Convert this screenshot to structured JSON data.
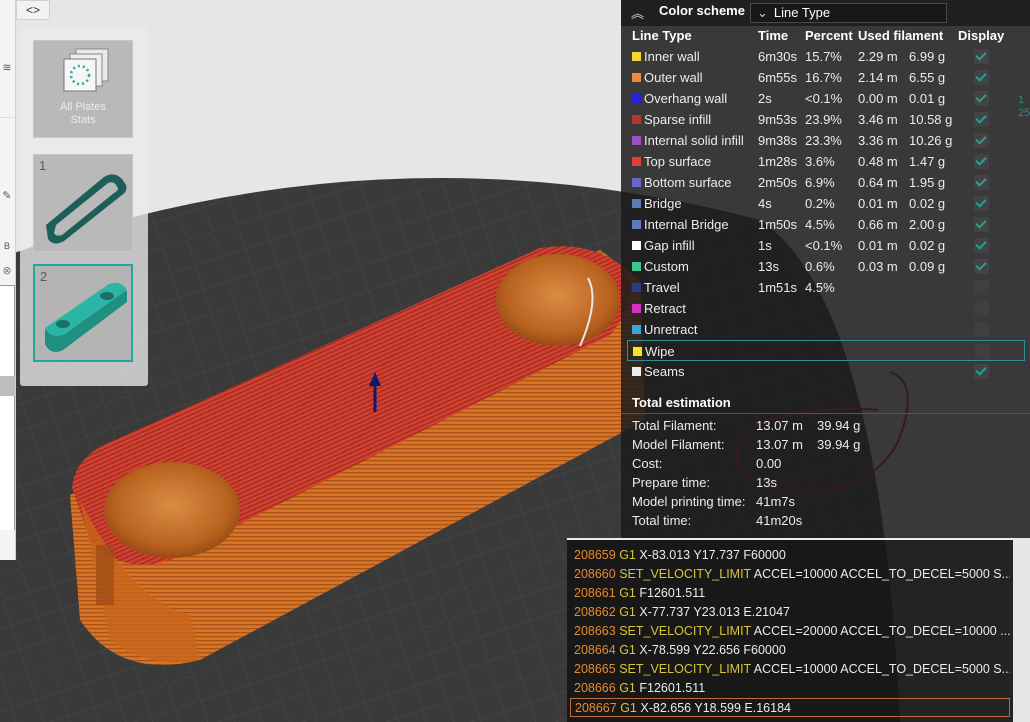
{
  "left_strip": {
    "icons": [
      "wifi-icon",
      "edit-icon",
      "b-badge-icon",
      "close-circle-icon"
    ],
    "badge_text": "B"
  },
  "collapse_glyph": "<>",
  "plates": {
    "all_label_line1": "All Plates",
    "all_label_line2": "Stats",
    "items": [
      {
        "number": "1"
      },
      {
        "number": "2"
      }
    ]
  },
  "legend": {
    "scheme_label": "Color scheme",
    "scheme_value": "Line Type",
    "headers": {
      "type": "Line Type",
      "time": "Time",
      "percent": "Percent",
      "filament": "Used filament",
      "display": "Display"
    },
    "rows": [
      {
        "name": "Inner wall",
        "color": "#f5d535",
        "time": "6m30s",
        "percent": "15.7%",
        "length": "2.29 m",
        "weight": "6.99 g",
        "checked": true
      },
      {
        "name": "Outer wall",
        "color": "#f0893a",
        "time": "6m55s",
        "percent": "16.7%",
        "length": "2.14 m",
        "weight": "6.55 g",
        "checked": true
      },
      {
        "name": "Overhang wall",
        "color": "#2323d8",
        "time": "2s",
        "percent": "<0.1%",
        "length": "0.00 m",
        "weight": "0.01 g",
        "checked": true
      },
      {
        "name": "Sparse infill",
        "color": "#b13a2e",
        "time": "9m53s",
        "percent": "23.9%",
        "length": "3.46 m",
        "weight": "10.58 g",
        "checked": true
      },
      {
        "name": "Internal solid infill",
        "color": "#9a4fc4",
        "time": "9m38s",
        "percent": "23.3%",
        "length": "3.36 m",
        "weight": "10.26 g",
        "checked": true
      },
      {
        "name": "Top surface",
        "color": "#e23c3c",
        "time": "1m28s",
        "percent": "3.6%",
        "length": "0.48 m",
        "weight": "1.47 g",
        "checked": true
      },
      {
        "name": "Bottom surface",
        "color": "#6a64c8",
        "time": "2m50s",
        "percent": "6.9%",
        "length": "0.64 m",
        "weight": "1.95 g",
        "checked": true
      },
      {
        "name": "Bridge",
        "color": "#5d7ab8",
        "time": "4s",
        "percent": "0.2%",
        "length": "0.01 m",
        "weight": "0.02 g",
        "checked": true
      },
      {
        "name": "Internal Bridge",
        "color": "#5d7ab8",
        "time": "1m50s",
        "percent": "4.5%",
        "length": "0.66 m",
        "weight": "2.00 g",
        "checked": true
      },
      {
        "name": "Gap infill",
        "color": "#ffffff",
        "time": "1s",
        "percent": "<0.1%",
        "length": "0.01 m",
        "weight": "0.02 g",
        "checked": true
      },
      {
        "name": "Custom",
        "color": "#3ec48a",
        "time": "13s",
        "percent": "0.6%",
        "length": "0.03 m",
        "weight": "0.09 g",
        "checked": true
      },
      {
        "name": "Travel",
        "color": "#2e3a8c",
        "time": "1m51s",
        "percent": "4.5%",
        "length": "",
        "weight": "",
        "checked": false
      },
      {
        "name": "Retract",
        "color": "#d42ec4",
        "time": "",
        "percent": "",
        "length": "",
        "weight": "",
        "checked": false
      },
      {
        "name": "Unretract",
        "color": "#3aa6d4",
        "time": "",
        "percent": "",
        "length": "",
        "weight": "",
        "checked": false
      },
      {
        "name": "Wipe",
        "color": "#f5e61a",
        "time": "",
        "percent": "",
        "length": "",
        "weight": "",
        "checked": false
      },
      {
        "name": "Seams",
        "color": "#eeeeee",
        "time": "",
        "percent": "",
        "length": "",
        "weight": "",
        "checked": true
      }
    ],
    "estimation_title": "Total estimation",
    "estimation": [
      {
        "label": "Total Filament:",
        "v1": "13.07 m",
        "v2": "39.94 g"
      },
      {
        "label": "Model Filament:",
        "v1": "13.07 m",
        "v2": "39.94 g"
      },
      {
        "label": "Cost:",
        "v1": "0.00",
        "v2": ""
      },
      {
        "label": "Prepare time:",
        "v1": "13s",
        "v2": ""
      },
      {
        "label": "Model printing time:",
        "v1": "41m7s",
        "v2": ""
      },
      {
        "label": "Total time:",
        "v1": "41m20s",
        "v2": ""
      }
    ]
  },
  "gcode": [
    {
      "line": "208659",
      "cmd": "G1",
      "params": "X-83.013 Y17.737 F60000"
    },
    {
      "line": "208660",
      "cmd": "SET_VELOCITY_LIMIT",
      "params": "ACCEL=10000 ACCEL_TO_DECEL=5000 S..."
    },
    {
      "line": "208661",
      "cmd": "G1",
      "params": "F12601.511"
    },
    {
      "line": "208662",
      "cmd": "G1",
      "params": "X-77.737 Y23.013 E.21047"
    },
    {
      "line": "208663",
      "cmd": "SET_VELOCITY_LIMIT",
      "params": "ACCEL=20000 ACCEL_TO_DECEL=10000 ..."
    },
    {
      "line": "208664",
      "cmd": "G1",
      "params": "X-78.599 Y22.656 F60000"
    },
    {
      "line": "208665",
      "cmd": "SET_VELOCITY_LIMIT",
      "params": "ACCEL=10000 ACCEL_TO_DECEL=5000 S..."
    },
    {
      "line": "208666",
      "cmd": "G1",
      "params": "F12601.511"
    },
    {
      "line": "208667",
      "cmd": "G1",
      "params": "X-82.656 Y18.599 E.16184",
      "current": true
    }
  ],
  "right_edge_text": [
    "1",
    "25"
  ],
  "colors": {
    "accent": "#21a89a",
    "annotation": "#c8201e",
    "model_orange": "#d9711f",
    "model_red": "#cc3a2f"
  }
}
